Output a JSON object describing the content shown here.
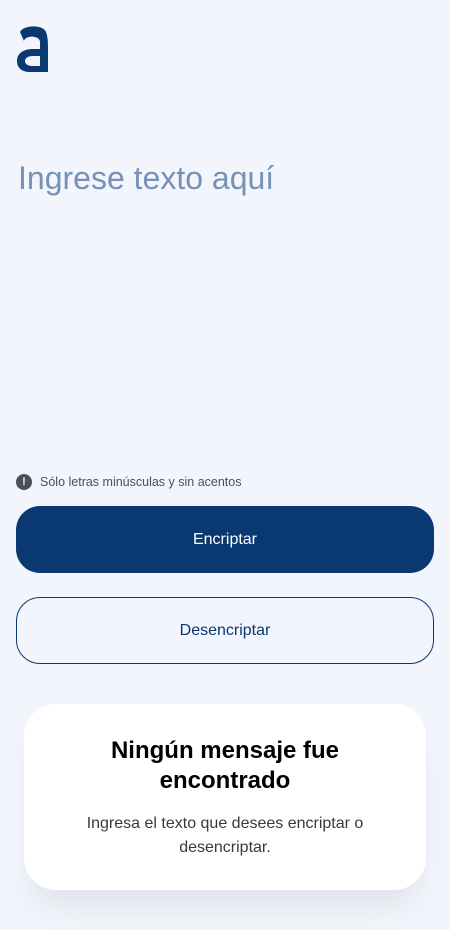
{
  "logo": {
    "letter": "a",
    "color": "#0a3871"
  },
  "input": {
    "placeholder": "Ingrese texto aquí",
    "value": ""
  },
  "hint": {
    "icon": "info-icon",
    "glyph": "!",
    "text": "Sólo letras minúsculas y sin acentos"
  },
  "buttons": {
    "encrypt_label": "Encriptar",
    "decrypt_label": "Desencriptar"
  },
  "result": {
    "title": "Ningún mensaje fue encontrado",
    "body": "Ingresa el texto que desees encriptar o desencriptar."
  },
  "colors": {
    "background": "#f3f5fc",
    "accent": "#0a3871",
    "placeholder": "#7691b6",
    "card": "#ffffff"
  }
}
